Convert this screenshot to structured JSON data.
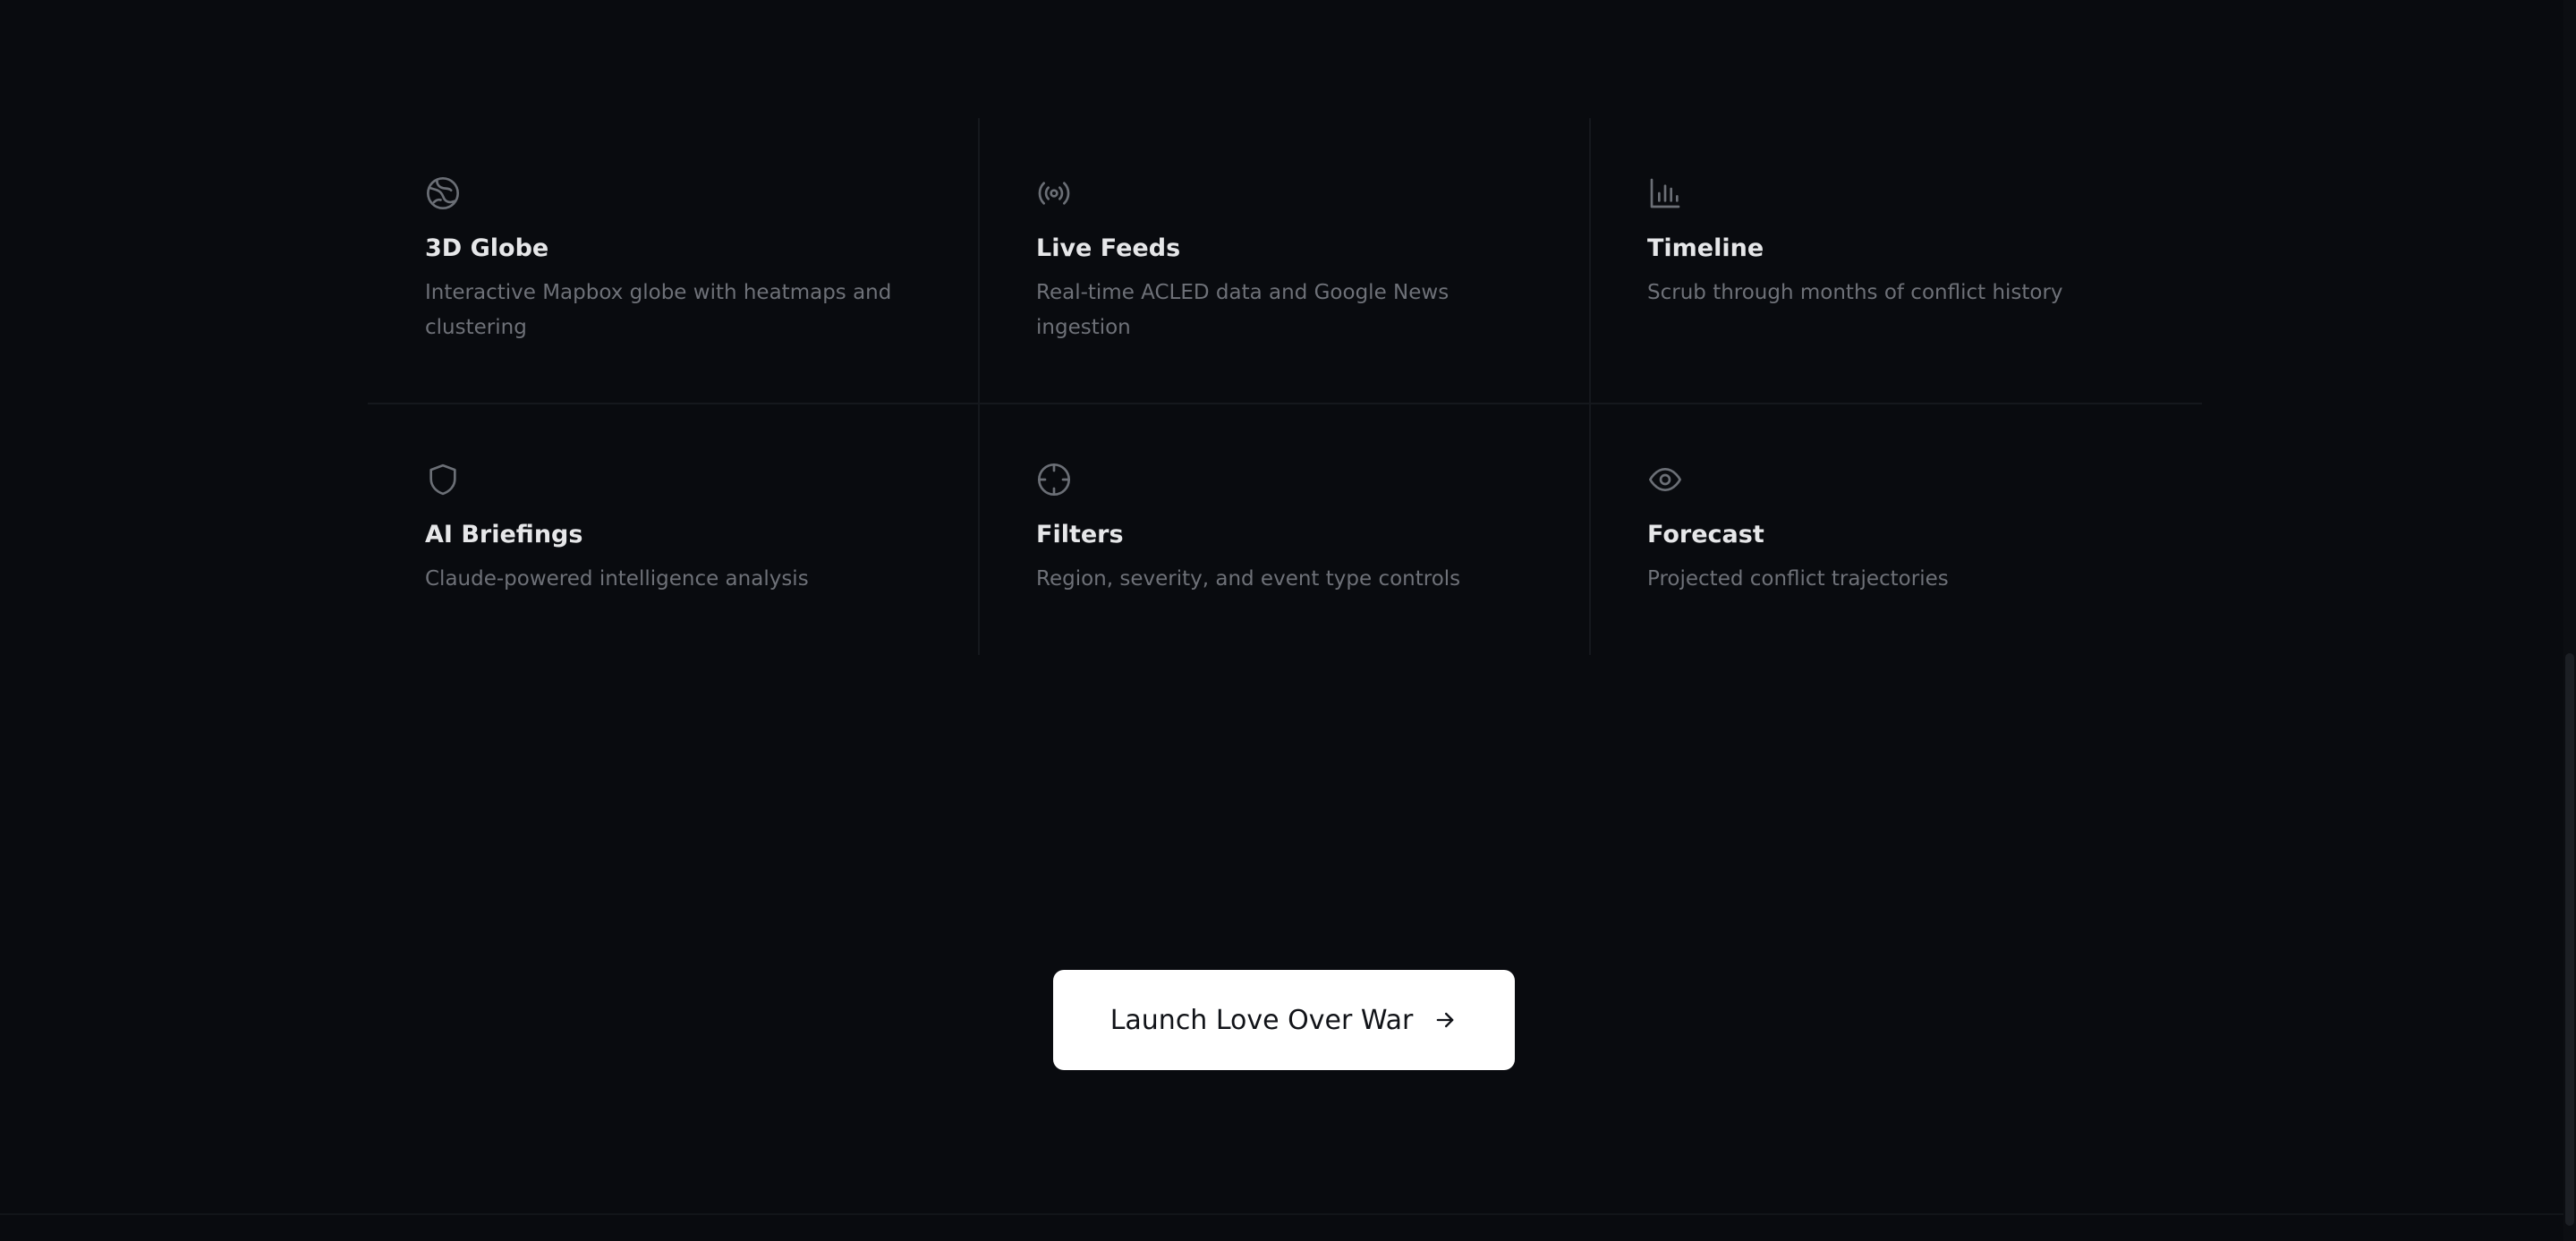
{
  "features": [
    {
      "icon": "globe-icon",
      "title": "3D Globe",
      "description": "Interactive Mapbox globe with heatmaps and clustering"
    },
    {
      "icon": "broadcast-icon",
      "title": "Live Feeds",
      "description": "Real-time ACLED data and Google News ingestion"
    },
    {
      "icon": "bar-chart-icon",
      "title": "Timeline",
      "description": "Scrub through months of conflict history"
    },
    {
      "icon": "shield-icon",
      "title": "AI Briefings",
      "description": "Claude-powered intelligence analysis"
    },
    {
      "icon": "crosshair-icon",
      "title": "Filters",
      "description": "Region, severity, and event type controls"
    },
    {
      "icon": "eye-icon",
      "title": "Forecast",
      "description": "Projected conflict trajectories"
    }
  ],
  "cta": {
    "label": "Launch Love Over War",
    "icon": "arrow-right-icon"
  },
  "colors": {
    "background": "#090b0f",
    "title": "#e6e7e9",
    "description": "#6e7178",
    "icon": "#6b6f76",
    "button_bg": "#ffffff",
    "button_text": "#111318"
  }
}
